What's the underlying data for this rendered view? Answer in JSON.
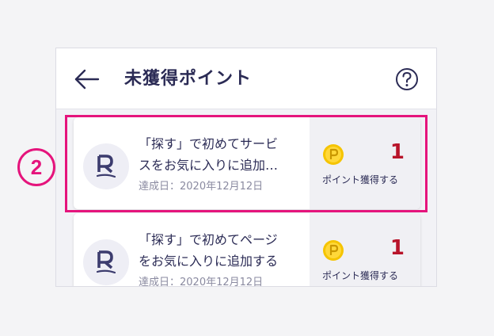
{
  "header": {
    "title": "未獲得ポイント",
    "back_icon": "arrow-left-icon",
    "help_icon": "question-circle-icon"
  },
  "items": [
    {
      "title_lines": [
        "「探す」で初めてサービ",
        "スをお気に入りに追加…"
      ],
      "date": "達成日：2020年12月12日",
      "points": "1",
      "reward_label": "ポイント獲得する",
      "logo_icon": "rakuten-r-logo-icon",
      "coin_icon": "point-coin-icon"
    },
    {
      "title_lines": [
        "「探す」で初めてページ",
        "をお気に入りに追加する"
      ],
      "date": "達成日：2020年12月12日",
      "points": "1",
      "reward_label": "ポイント獲得する",
      "logo_icon": "rakuten-r-logo-icon",
      "coin_icon": "point-coin-icon"
    }
  ],
  "annotation": {
    "step_number": "2"
  },
  "colors": {
    "accent": "#e5147c",
    "points": "#b8142a",
    "text": "#2b2b55",
    "coin": "#f5c400"
  }
}
